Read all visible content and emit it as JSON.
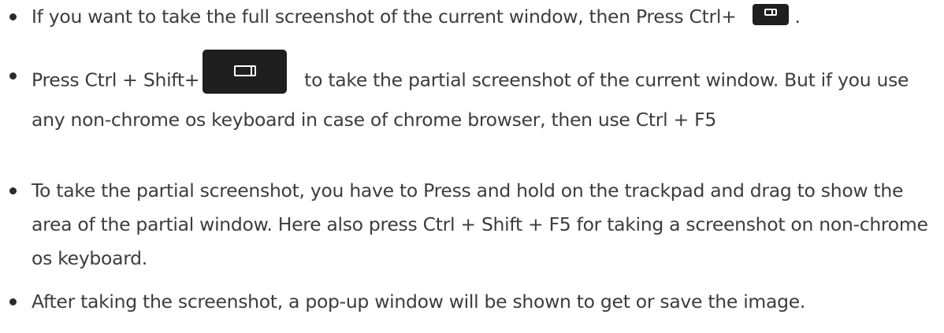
{
  "items": [
    {
      "before_key": "If you want to take the full screenshot of the current window, then Press Ctrl+",
      "key_icon": "window-overview-key-icon",
      "after_key": "."
    },
    {
      "before_key": "Press Ctrl + Shift+",
      "key_icon": "window-overview-key-icon",
      "after_key": "to take the partial screenshot of the current window. But if you use any non-chrome os keyboard in case of chrome browser, then use Ctrl + F5"
    },
    {
      "text": "To take the partial screenshot, you have to Press and hold on the trackpad and drag to show the area of the partial window. Here also press Ctrl + Shift + F5 for taking a screenshot on non-chrome os keyboard."
    },
    {
      "text": "After taking the screenshot, a pop-up window will be shown to get or save the image."
    }
  ]
}
